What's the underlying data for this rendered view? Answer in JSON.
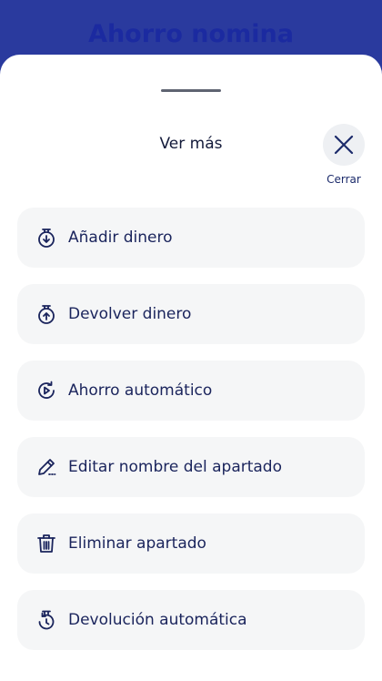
{
  "header": {
    "title": "Ahorro nomina"
  },
  "sheet": {
    "title": "Ver más",
    "close_label": "Cerrar"
  },
  "menu": [
    {
      "label": "Añadir dinero",
      "icon": "add-money-icon"
    },
    {
      "label": "Devolver dinero",
      "icon": "return-money-icon"
    },
    {
      "label": "Ahorro automático",
      "icon": "auto-save-icon"
    },
    {
      "label": "Editar nombre del apartado",
      "icon": "edit-pencil-icon"
    },
    {
      "label": "Eliminar apartado",
      "icon": "trash-icon"
    },
    {
      "label": "Devolución automática",
      "icon": "auto-return-icon"
    }
  ],
  "colors": {
    "header_bg": "#2a3a9e",
    "text_dark": "#1a245c",
    "item_bg": "#f5f6f7"
  }
}
